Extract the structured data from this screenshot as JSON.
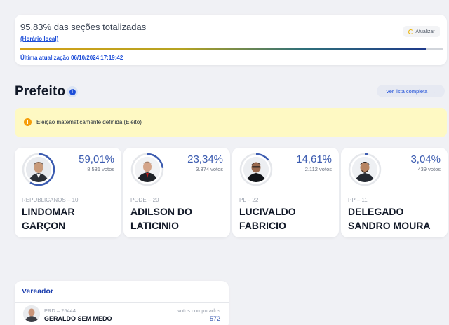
{
  "status": {
    "title": "95,83% das seções totalizadas",
    "subtitle": "(Horário local)",
    "refresh_label": "Atualizar",
    "progress_fraction": 0.9583,
    "updated": "Última atualização 06/10/2024 17:19:42"
  },
  "section": {
    "title": "Prefeito",
    "info_glyph": "i",
    "full_list_label": "Ver lista completa",
    "full_list_arrow": "→"
  },
  "alert": {
    "icon_glyph": "!",
    "text": "Eleição matematicamente definida (Eleito)"
  },
  "candidates": [
    {
      "percent": "59,01%",
      "votes": "8.531 votos",
      "party": "REPUBLICANOS – 10",
      "name": "LINDOMAR GARÇON",
      "share": 0.5901
    },
    {
      "percent": "23,34%",
      "votes": "3.374 votos",
      "party": "PODE – 20",
      "name": "ADILSON DO LATICINIO",
      "share": 0.2334
    },
    {
      "percent": "14,61%",
      "votes": "2.112 votos",
      "party": "PL – 22",
      "name": "LUCIVALDO FABRICIO",
      "share": 0.1461
    },
    {
      "percent": "3,04%",
      "votes": "439 votos",
      "party": "PP – 11",
      "name": "DELEGADO SANDRO MOURA",
      "share": 0.0304
    }
  ],
  "vereador": {
    "title": "Vereador",
    "party": "PRD – 25444",
    "name": "GERALDO SEM MEDO",
    "votes_label": "votos computados",
    "votes_value": "572"
  },
  "colors": {
    "accent_blue": "#1d4ed8",
    "percent_blue": "#3b5bb0",
    "alert_bg": "#fef9c3",
    "alert_icon": "#f59e0b"
  }
}
